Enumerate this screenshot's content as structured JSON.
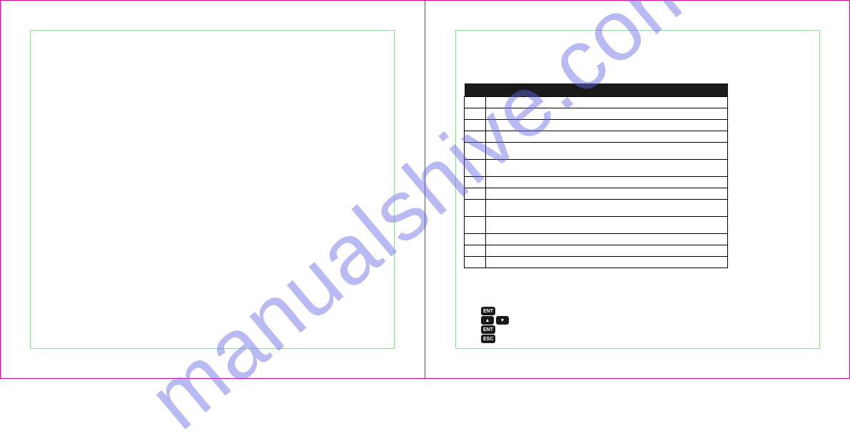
{
  "watermark": "manualshive.com",
  "table": {
    "header": {
      "col1": "",
      "col2": ""
    },
    "rows": [
      {
        "num": "",
        "desc": "",
        "tall": false
      },
      {
        "num": "",
        "desc": "",
        "tall": false
      },
      {
        "num": "",
        "desc": "",
        "tall": false
      },
      {
        "num": "",
        "desc": "",
        "tall": false
      },
      {
        "num": "",
        "desc": "",
        "tall": true
      },
      {
        "num": "",
        "desc": "",
        "tall": true
      },
      {
        "num": "",
        "desc": "",
        "tall": false
      },
      {
        "num": "",
        "desc": "",
        "tall": false
      },
      {
        "num": "",
        "desc": "",
        "tall": true
      },
      {
        "num": "",
        "desc": "",
        "tall": true
      },
      {
        "num": "",
        "desc": "",
        "tall": false
      },
      {
        "num": "",
        "desc": "",
        "tall": false
      },
      {
        "num": "",
        "desc": "",
        "tall": false
      }
    ]
  },
  "keys": {
    "ent": "ENT",
    "up": "▲",
    "down": "▼",
    "esc": "ESC"
  }
}
